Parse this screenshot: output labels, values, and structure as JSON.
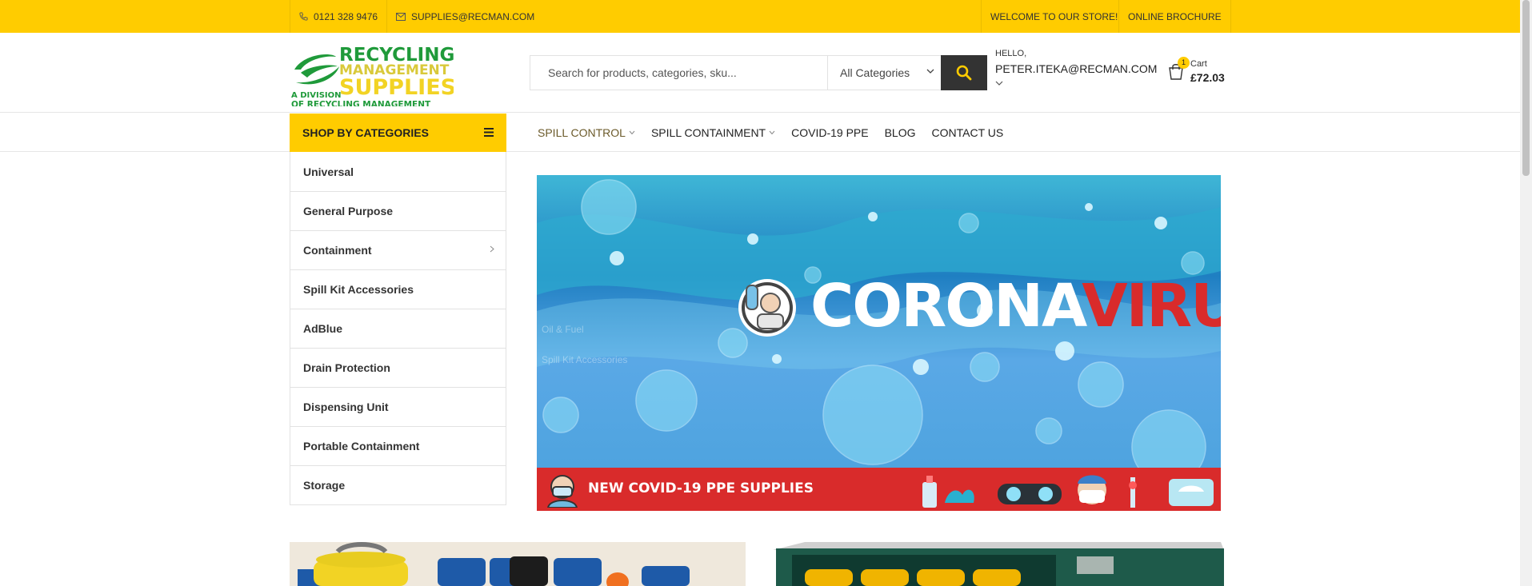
{
  "topbar": {
    "phone": "0121 328 9476",
    "email": "SUPPLIES@RECMAN.COM",
    "welcome": "WELCOME TO OUR STORE!",
    "brochure": "ONLINE BROCHURE"
  },
  "logo": {
    "line1": "RECYCLING",
    "line2": "MANAGEMENT",
    "line3": "SUPPLIES",
    "sub1": "A DIVISION",
    "sub2": "OF RECYCLING MANAGEMENT"
  },
  "search": {
    "placeholder": "Search for products, categories, sku...",
    "category": "All Categories"
  },
  "user": {
    "hello": "HELLO,",
    "email": "PETER.ITEKA@RECMAN.COM"
  },
  "cart": {
    "count": "1",
    "label": "Cart",
    "total": "£72.03"
  },
  "categories_button": "SHOP BY CATEGORIES",
  "nav": [
    {
      "label": "SPILL CONTROL"
    },
    {
      "label": "SPILL CONTAINMENT"
    },
    {
      "label": "COVID-19 PPE"
    },
    {
      "label": "BLOG"
    },
    {
      "label": "CONTACT US"
    }
  ],
  "sidebar": [
    {
      "label": "Universal"
    },
    {
      "label": "General Purpose"
    },
    {
      "label": "Containment"
    },
    {
      "label": "Spill Kit Accessories"
    },
    {
      "label": "AdBlue"
    },
    {
      "label": "Drain Protection"
    },
    {
      "label": "Dispensing Unit"
    },
    {
      "label": "Portable Containment"
    },
    {
      "label": "Storage"
    }
  ],
  "banner": {
    "title_white": "CORONA",
    "title_red": "VIRUS",
    "strip": "NEW COVID-19 PPE SUPPLIES",
    "ghost1": "Oil & Fuel",
    "ghost2": "Spill Kit Accessories"
  },
  "colors": {
    "accent": "#ffcc00",
    "dark": "#333333",
    "red": "#d92b2b"
  }
}
